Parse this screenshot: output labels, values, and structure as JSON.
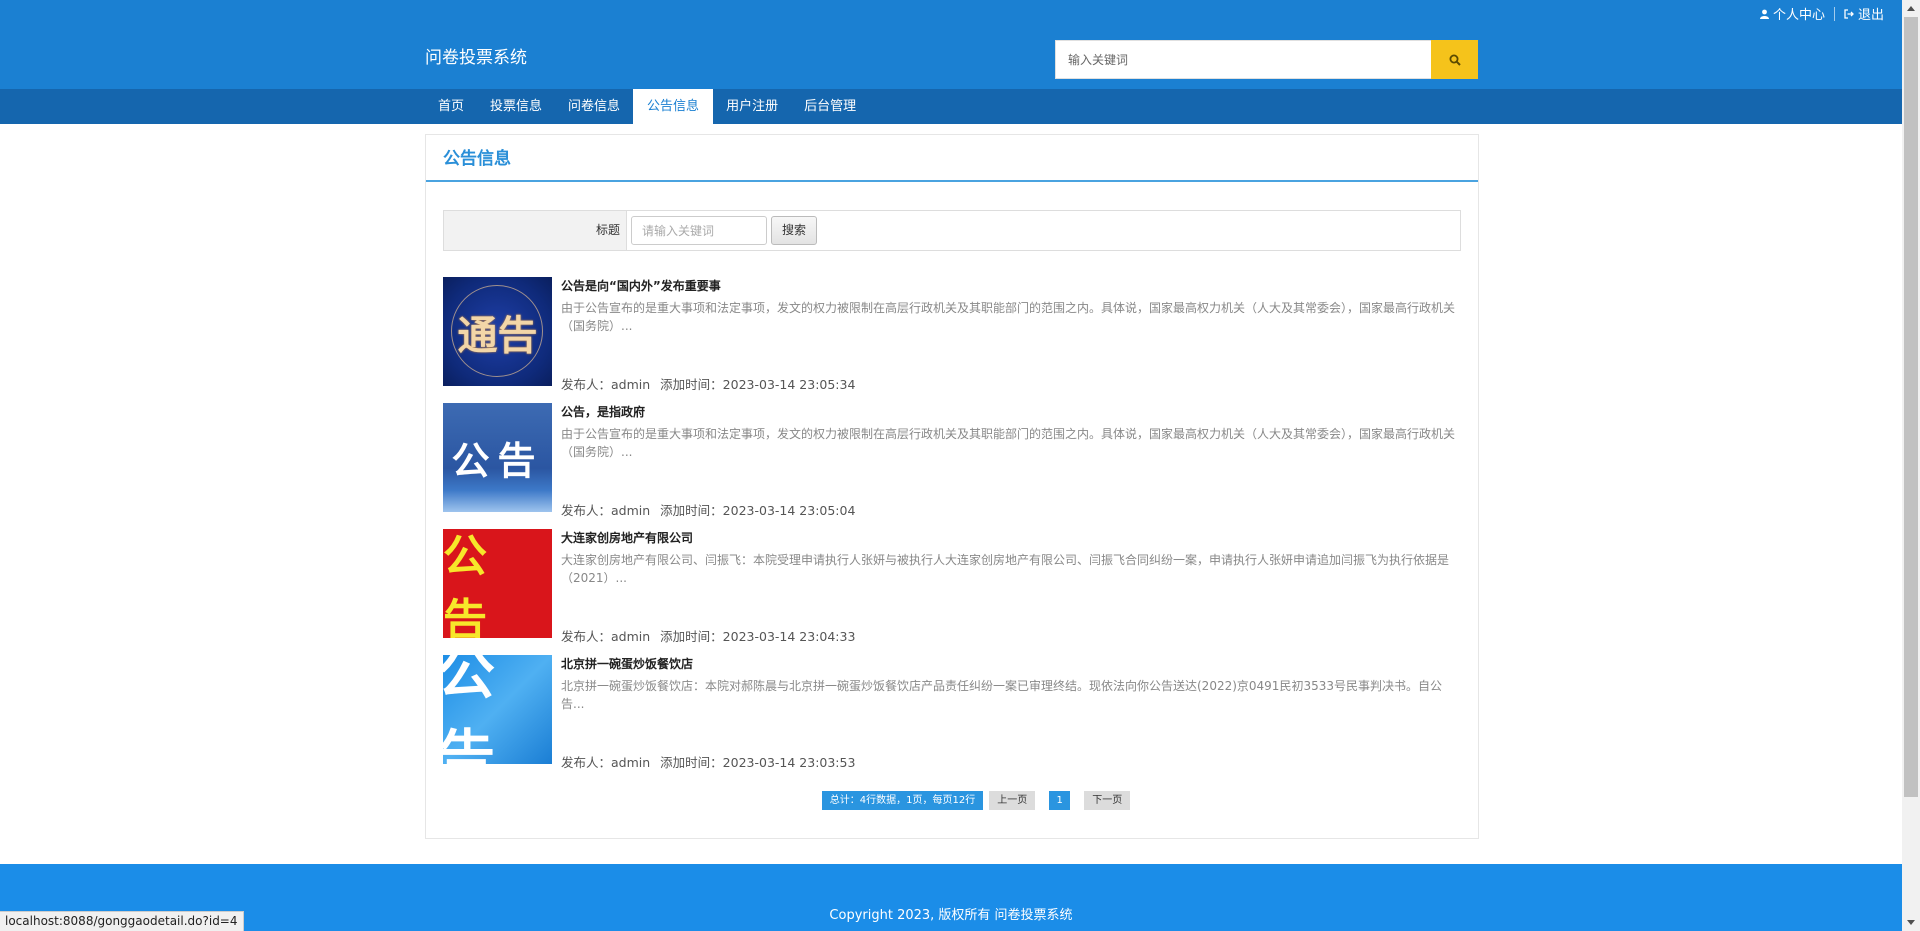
{
  "header": {
    "site_title": "问卷投票系统",
    "user_center": "个人中心",
    "logout": "退出",
    "search_placeholder": "输入关键词"
  },
  "nav": [
    {
      "label": "首页",
      "active": false
    },
    {
      "label": "投票信息",
      "active": false
    },
    {
      "label": "问卷信息",
      "active": false
    },
    {
      "label": "公告信息",
      "active": true
    },
    {
      "label": "用户注册",
      "active": false
    },
    {
      "label": "后台管理",
      "active": false
    }
  ],
  "panel": {
    "title": "公告信息",
    "filter_label": "标题",
    "filter_placeholder": "请输入关键词",
    "search_button": "搜索"
  },
  "notices": [
    {
      "title": "公告是向“国内外”发布重要事",
      "desc": "由于公告宣布的是重大事项和法定事项，发文的权力被限制在高层行政机关及其职能部门的范围之内。具体说，国家最高权力机关（人大及其常委会），国家最高行政机关（国务院）...",
      "publisher": "发布人：admin",
      "time": "添加时间：2023-03-14 23:05:34",
      "thumb_text": "通告"
    },
    {
      "title": "公告，是指政府",
      "desc": "由于公告宣布的是重大事项和法定事项，发文的权力被限制在高层行政机关及其职能部门的范围之内。具体说，国家最高权力机关（人大及其常委会），国家最高行政机关（国务院）...",
      "publisher": "发布人：admin",
      "time": "添加时间：2023-03-14 23:05:04",
      "thumb_text": "公告"
    },
    {
      "title": "大连家创房地产有限公司",
      "desc": "大连家创房地产有限公司、闫振飞：本院受理申请执行人张妍与被执行人大连家创房地产有限公司、闫振飞合同纠纷一案，申请执行人张妍申请追加闫振飞为执行依据是（2021）...",
      "publisher": "发布人：admin",
      "time": "添加时间：2023-03-14 23:04:33",
      "thumb_text": "公告"
    },
    {
      "title": "北京拼一碗蛋炒饭餐饮店",
      "desc": "北京拼一碗蛋炒饭餐饮店：本院对郝陈晨与北京拼一碗蛋炒饭餐饮店产品责任纠纷一案已审理终结。现依法向你公告送达(2022)京0491民初3533号民事判决书。自公告...",
      "publisher": "发布人：admin",
      "time": "添加时间：2023-03-14 23:03:53",
      "thumb_text": "公告"
    }
  ],
  "pager": {
    "info": "总计：4行数据，1页，每页12行",
    "prev": "上一页",
    "current": "1",
    "next": "下一页"
  },
  "footer": {
    "copyright": "Copyright 2023, 版权所有 问卷投票系统"
  },
  "status_bar": {
    "url": "localhost:8088/gonggaodetail.do?id=4"
  },
  "colors": {
    "header_bg": "#1b80d2",
    "nav_bg": "#1566ae",
    "search_button": "#f5c31b",
    "footer_bg": "#1b8de8",
    "accent": "#2a95e0"
  }
}
